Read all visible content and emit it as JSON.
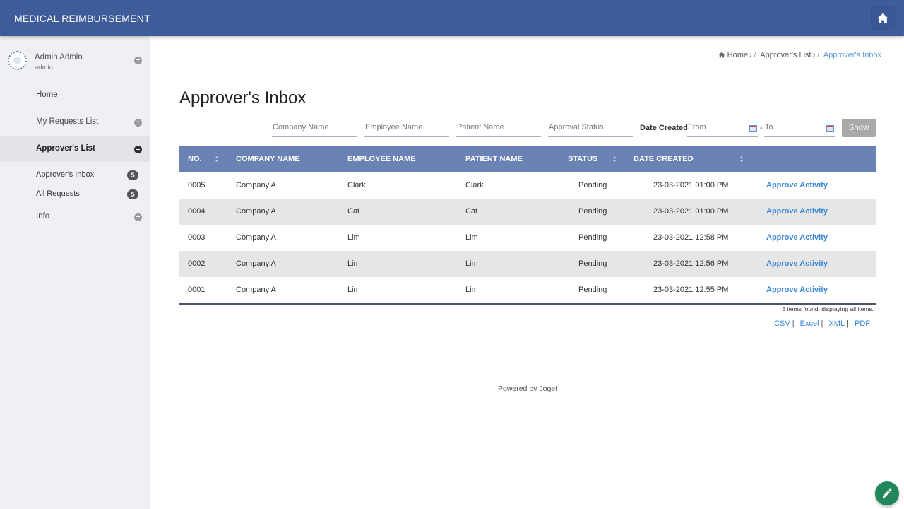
{
  "header": {
    "title": "MEDICAL REIMBURSEMENT",
    "home_icon": "home-icon"
  },
  "sidebar": {
    "profile": {
      "name": "Admin Admin",
      "role": "admin"
    },
    "items": [
      {
        "label": "Home"
      },
      {
        "label": "My Requests List"
      },
      {
        "label": "Approver's List"
      },
      {
        "label": "Info"
      }
    ],
    "subitems": [
      {
        "label": "Approver's Inbox",
        "badge": "5"
      },
      {
        "label": "All Requests",
        "badge": "5"
      }
    ]
  },
  "breadcrumb": {
    "home": "Home",
    "sep1": "›",
    "slash1": "/",
    "parent": "Approver's List",
    "sep2": "›",
    "slash2": "/",
    "current": "Approver's Inbox"
  },
  "page": {
    "title": "Approver's Inbox"
  },
  "filters": {
    "company_placeholder": "Company Name",
    "employee_placeholder": "Employee Name",
    "patient_placeholder": "Patient Name",
    "status_placeholder": "Approval Status",
    "date_label": "Date Created",
    "from_placeholder": "From",
    "to_placeholder": "To",
    "dash": "-",
    "show_label": "Show"
  },
  "table": {
    "headers": {
      "no": "NO.",
      "company": "COMPANY NAME",
      "employee": "EMPLOYEE NAME",
      "patient": "PATIENT NAME",
      "status": "STATUS",
      "date": "DATE CREATED"
    },
    "action_label": "Approve Activity",
    "rows": [
      {
        "no": "0005",
        "company": "Company A",
        "employee": "Clark",
        "patient": "Clark",
        "status": "Pending",
        "date": "23-03-2021 01:00 PM"
      },
      {
        "no": "0004",
        "company": "Company A",
        "employee": "Cat",
        "patient": "Cat",
        "status": "Pending",
        "date": "23-03-2021 01:00 PM"
      },
      {
        "no": "0003",
        "company": "Company A",
        "employee": "Lim",
        "patient": "Lim",
        "status": "Pending",
        "date": "23-03-2021 12:58 PM"
      },
      {
        "no": "0002",
        "company": "Company A",
        "employee": "Lim",
        "patient": "Lim",
        "status": "Pending",
        "date": "23-03-2021 12:56 PM"
      },
      {
        "no": "0001",
        "company": "Company A",
        "employee": "Lim",
        "patient": "Lim",
        "status": "Pending",
        "date": "23-03-2021 12:55 PM"
      }
    ],
    "summary": "5 items found, displaying all items."
  },
  "exports": {
    "csv": "CSV",
    "excel": "Excel",
    "xml": "XML",
    "pdf": "PDF",
    "bar": "|"
  },
  "footer": {
    "powered": "Powered by Joget"
  },
  "colors": {
    "header": "#3e5b9a",
    "table_header": "#6b82b5",
    "link": "#3a86d6",
    "fab": "#21875a"
  }
}
